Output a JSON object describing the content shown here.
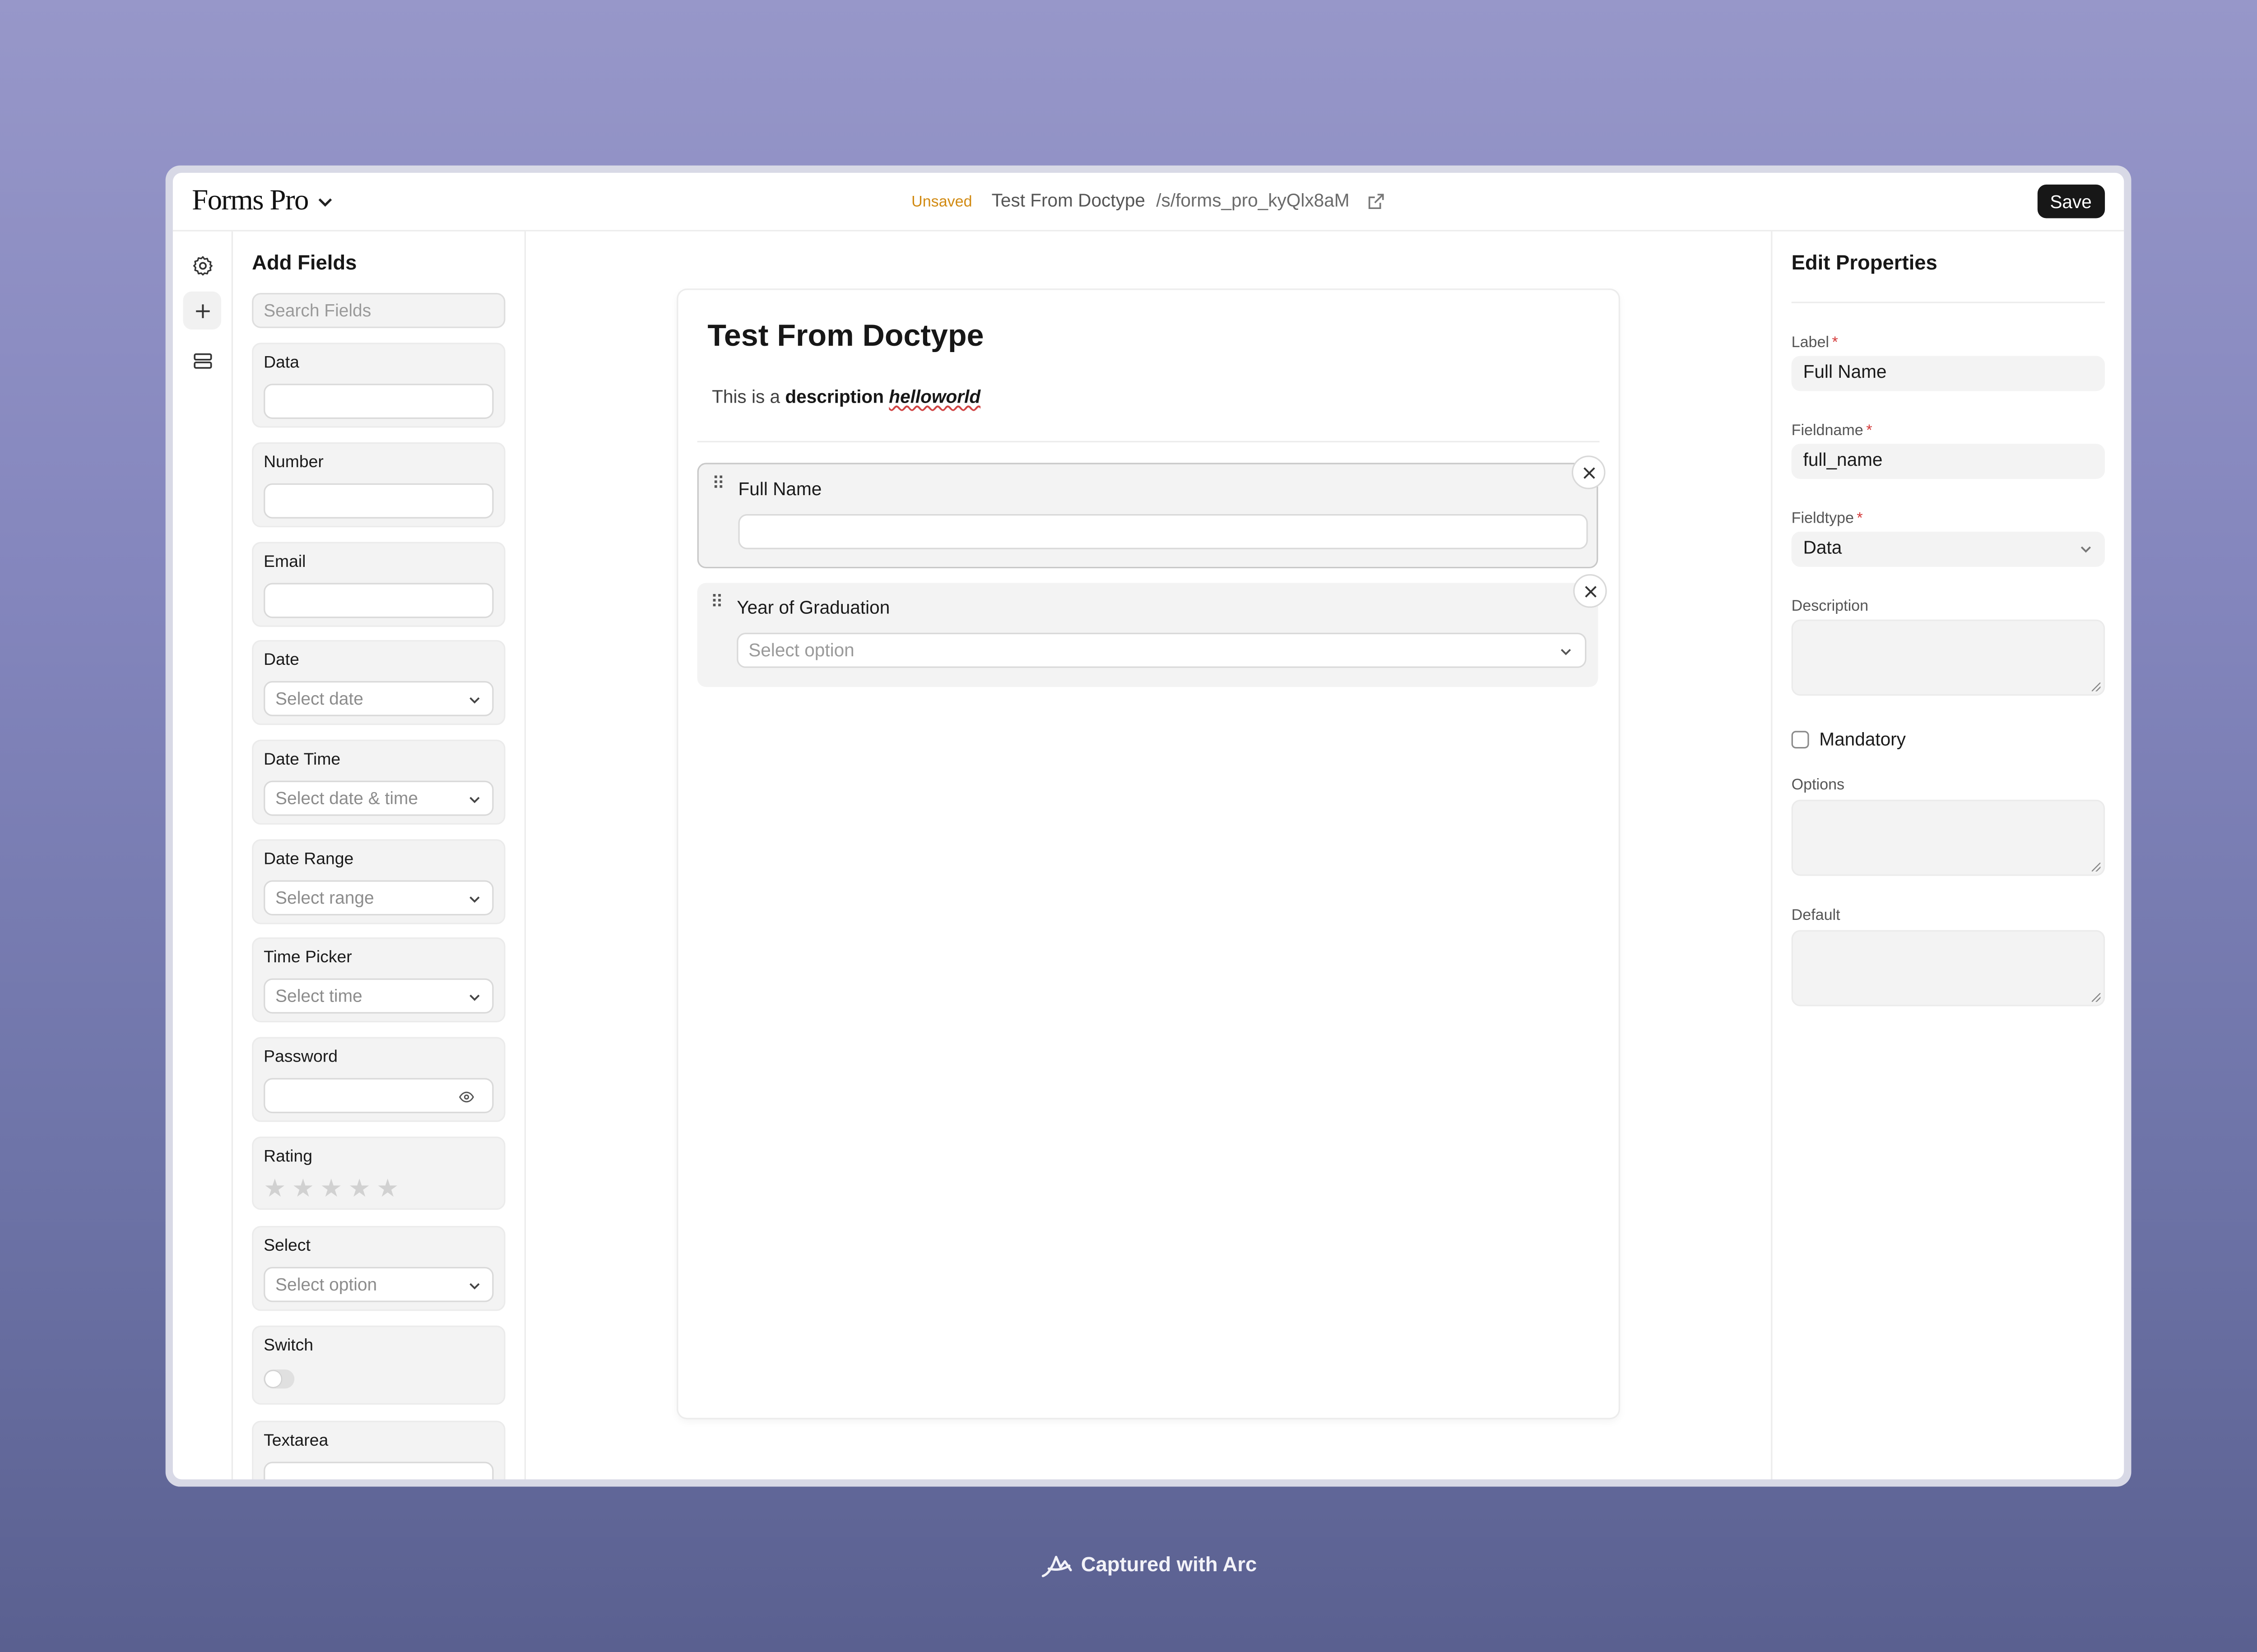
{
  "header": {
    "brand": "Forms Pro",
    "status": "Unsaved",
    "form_title": "Test From Doctype",
    "route": "/s/forms_pro_kyQlx8aM",
    "save_label": "Save"
  },
  "add_fields": {
    "title": "Add Fields",
    "search_placeholder": "Search Fields",
    "fields": [
      {
        "label": "Data",
        "placeholder": ""
      },
      {
        "label": "Number",
        "placeholder": ""
      },
      {
        "label": "Email",
        "placeholder": ""
      },
      {
        "label": "Date",
        "placeholder": "Select date"
      },
      {
        "label": "Date Time",
        "placeholder": "Select date & time"
      },
      {
        "label": "Date Range",
        "placeholder": "Select range"
      },
      {
        "label": "Time Picker",
        "placeholder": "Select time"
      },
      {
        "label": "Password",
        "placeholder": ""
      },
      {
        "label": "Rating",
        "placeholder": ""
      },
      {
        "label": "Select",
        "placeholder": "Select option"
      },
      {
        "label": "Switch",
        "placeholder": ""
      },
      {
        "label": "Textarea",
        "placeholder": ""
      }
    ]
  },
  "form": {
    "title": "Test From Doctype",
    "description_prefix": "This is a ",
    "description_bold": "description",
    "description_italic": "helloworld",
    "fields": [
      {
        "label": "Full Name",
        "placeholder": ""
      },
      {
        "label": "Year of Graduation",
        "placeholder": "Select option"
      }
    ]
  },
  "properties": {
    "title": "Edit Properties",
    "label_label": "Label",
    "label_value": "Full Name",
    "fieldname_label": "Fieldname",
    "fieldname_value": "full_name",
    "fieldtype_label": "Fieldtype",
    "fieldtype_value": "Data",
    "description_label": "Description",
    "mandatory_label": "Mandatory",
    "options_label": "Options",
    "default_label": "Default",
    "required_mark": "*"
  },
  "footer": {
    "captured": "Captured with Arc"
  },
  "colors": {
    "unsaved": "#d18a12",
    "save_bg": "#171717",
    "required": "#d43a3a"
  }
}
